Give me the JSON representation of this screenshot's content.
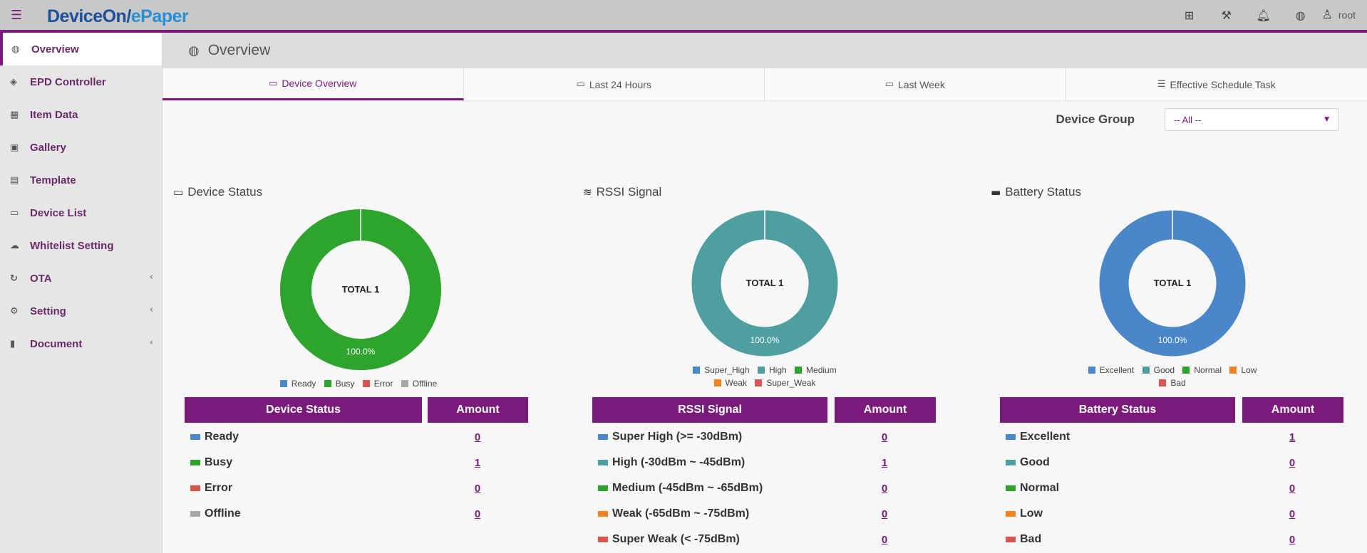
{
  "header": {
    "menu_icon": "hamburger-icon",
    "logo_part1": "DeviceOn/",
    "logo_part2": "ePaper",
    "icons": [
      "plus-square-icon",
      "gavel-icon",
      "bell-icon",
      "globe-icon",
      "user-icon"
    ],
    "username": "root"
  },
  "sidebar": {
    "items": [
      {
        "label": "Overview",
        "icon": "globe-icon",
        "active": true
      },
      {
        "label": "EPD Controller",
        "icon": "tags-icon"
      },
      {
        "label": "Item Data",
        "icon": "table-icon"
      },
      {
        "label": "Gallery",
        "icon": "image-icon"
      },
      {
        "label": "Template",
        "icon": "id-card-icon"
      },
      {
        "label": "Device List",
        "icon": "desktop-icon"
      },
      {
        "label": "Whitelist Setting",
        "icon": "cloud-upload-icon"
      },
      {
        "label": "OTA",
        "icon": "refresh-icon",
        "has_submenu": true
      },
      {
        "label": "Setting",
        "icon": "cogs-icon",
        "has_submenu": true
      },
      {
        "label": "Document",
        "icon": "book-icon",
        "has_submenu": true
      }
    ]
  },
  "page": {
    "title": "Overview",
    "title_icon": "globe-icon"
  },
  "tabs": [
    {
      "label": "Device Overview",
      "icon": "laptop-icon",
      "active": true
    },
    {
      "label": "Last 24 Hours",
      "icon": "laptop-icon"
    },
    {
      "label": "Last Week",
      "icon": "laptop-icon"
    },
    {
      "label": "Effective Schedule Task",
      "icon": "tasks-icon"
    }
  ],
  "filter": {
    "label": "Device Group",
    "selected": "-- All --"
  },
  "panels": {
    "device_status": {
      "title": "Device Status",
      "icon": "desktop-icon",
      "total_label": "TOTAL 1",
      "slice_label": "100.0%",
      "table_header": "Device Status",
      "amount_header": "Amount",
      "legend": [
        "Ready",
        "Busy",
        "Error",
        "Offline"
      ],
      "rows": [
        {
          "label": "Ready",
          "value": "0",
          "color": "#4a87c8"
        },
        {
          "label": "Busy",
          "value": "1",
          "color": "#2ea32e"
        },
        {
          "label": "Error",
          "value": "0",
          "color": "#d9534f"
        },
        {
          "label": "Offline",
          "value": "0",
          "color": "#a6a6a6"
        }
      ]
    },
    "rssi": {
      "title": "RSSI Signal",
      "icon": "wifi-icon",
      "total_label": "TOTAL 1",
      "slice_label": "100.0%",
      "table_header": "RSSI Signal",
      "amount_header": "Amount",
      "legend": [
        "Super_High",
        "High",
        "Medium",
        "Weak",
        "Super_Weak"
      ],
      "rows": [
        {
          "label": "Super High (>= -30dBm)",
          "value": "0",
          "color": "#4a87c8"
        },
        {
          "label": "High (-30dBm ~ -45dBm)",
          "value": "1",
          "color": "#4f9ea0"
        },
        {
          "label": "Medium (-45dBm ~ -65dBm)",
          "value": "0",
          "color": "#2ea32e"
        },
        {
          "label": "Weak (-65dBm ~ -75dBm)",
          "value": "0",
          "color": "#f0831e"
        },
        {
          "label": "Super Weak (< -75dBm)",
          "value": "0",
          "color": "#d9534f"
        }
      ]
    },
    "battery": {
      "title": "Battery Status",
      "icon": "battery-icon",
      "total_label": "TOTAL 1",
      "slice_label": "100.0%",
      "table_header": "Battery Status",
      "amount_header": "Amount",
      "legend": [
        "Excellent",
        "Good",
        "Normal",
        "Low",
        "Bad"
      ],
      "rows": [
        {
          "label": "Excellent",
          "value": "1",
          "color": "#4a87c8"
        },
        {
          "label": "Good",
          "value": "0",
          "color": "#4f9ea0"
        },
        {
          "label": "Normal",
          "value": "0",
          "color": "#2ea32e"
        },
        {
          "label": "Low",
          "value": "0",
          "color": "#f0831e"
        },
        {
          "label": "Bad",
          "value": "0",
          "color": "#d9534f"
        }
      ]
    }
  },
  "colors": {
    "accent": "#7b1a7b",
    "busy_green": "#2ea32e",
    "high_teal": "#4f9ea0",
    "excellent_blue": "#4a87c8"
  }
}
